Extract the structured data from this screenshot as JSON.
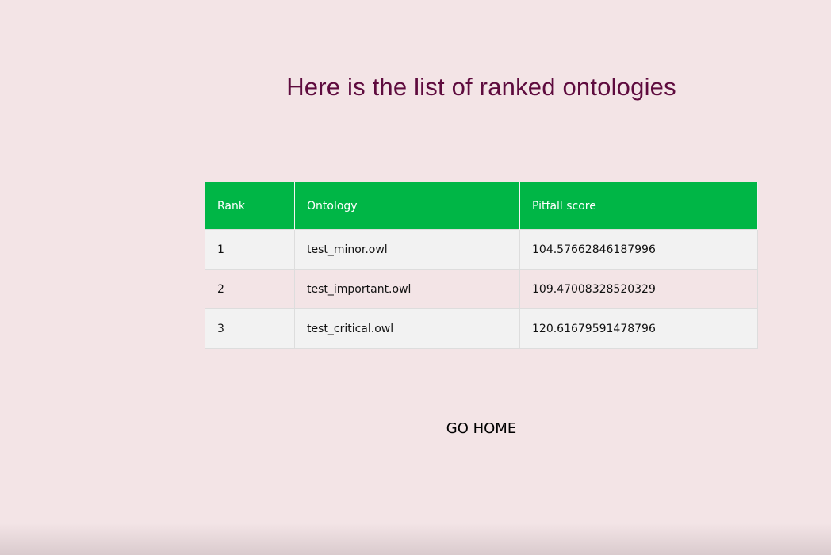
{
  "page": {
    "title": "Here is the list of ranked ontologies",
    "background_color": "#f3e4e6",
    "title_color": "#5e0b3e"
  },
  "table": {
    "header_color": "#00b646",
    "headers": [
      "Rank",
      "Ontology",
      "Pitfall score"
    ],
    "rows": [
      [
        "1",
        "test_minor.owl",
        "104.57662846187996"
      ],
      [
        "2",
        "test_important.owl",
        "109.47008328520329"
      ],
      [
        "3",
        "test_critical.owl",
        "120.61679591478796"
      ]
    ]
  },
  "nav": {
    "home_label": "GO HOME"
  }
}
